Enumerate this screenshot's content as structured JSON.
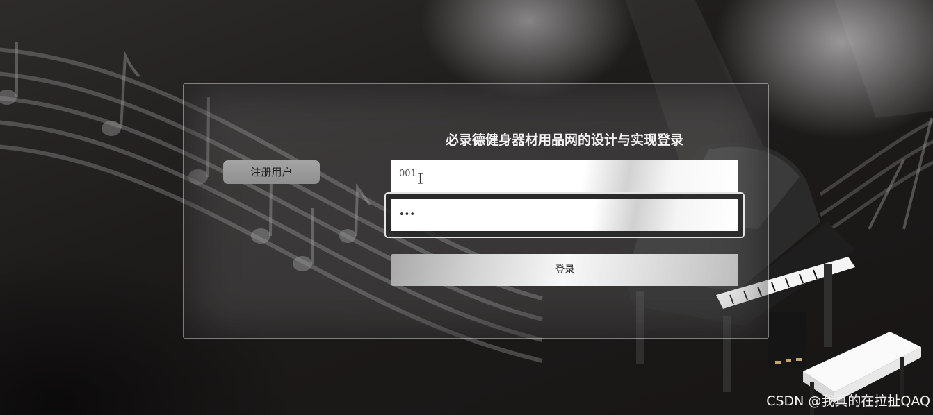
{
  "login": {
    "title": "必录德健身器材用品网的设计与实现登录",
    "register_label": "注册用户",
    "username_value": "001",
    "password_value": "•••",
    "login_label": "登录"
  },
  "watermark": "CSDN @我真的在拉扯QAQ",
  "colors": {
    "background": "#1b1818",
    "panel_border": "#e4e4e4",
    "button_gray": "#9b9b9b"
  }
}
